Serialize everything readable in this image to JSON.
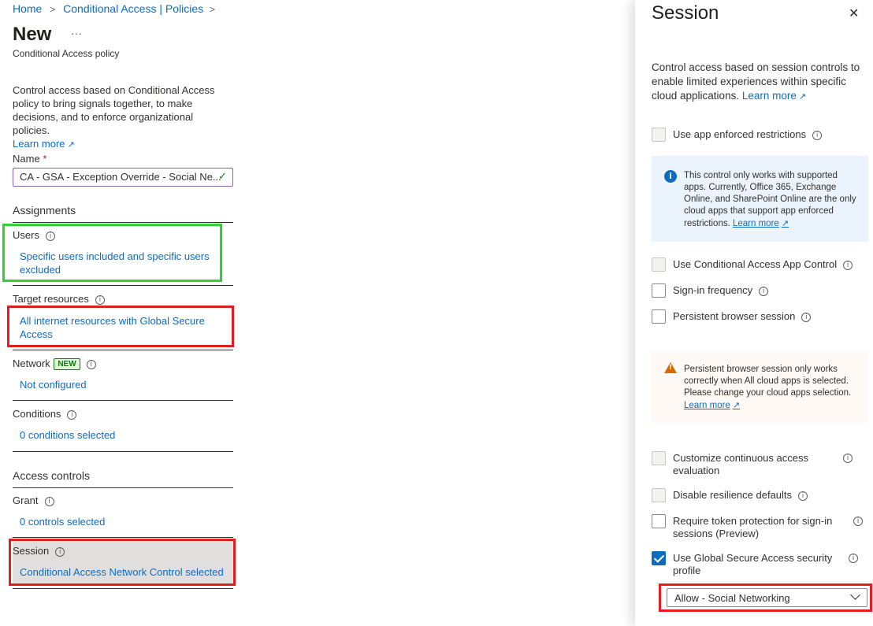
{
  "breadcrumb": {
    "home": "Home",
    "sep1": ">",
    "section": "Conditional Access | Policies",
    "sep2": ">"
  },
  "page": {
    "title": "New",
    "more": "···",
    "subtitle": "Conditional Access policy"
  },
  "intro": {
    "text": "Control access based on Conditional Access policy to bring signals together, to make decisions, and to enforce organizational policies.",
    "learn_more": "Learn more"
  },
  "name_field": {
    "label": "Name",
    "required": "*",
    "value": "CA - GSA - Exception Override - Social Ne...",
    "check": "✓"
  },
  "assignments": {
    "heading": "Assignments",
    "users": {
      "label": "Users",
      "value": "Specific users included and specific users excluded"
    },
    "target": {
      "label": "Target resources",
      "value": "All internet resources with Global Secure Access"
    },
    "network": {
      "label": "Network",
      "badge": "NEW",
      "value": "Not configured"
    },
    "conditions": {
      "label": "Conditions",
      "value": "0 conditions selected"
    }
  },
  "access_controls": {
    "heading": "Access controls",
    "grant": {
      "label": "Grant",
      "value": "0 controls selected"
    },
    "session": {
      "label": "Session",
      "value": "Conditional Access Network Control selected"
    }
  },
  "panel": {
    "title": "Session",
    "close": "✕",
    "description": "Control access based on session controls to enable limited experiences within specific cloud applications.",
    "learn_more": "Learn more",
    "app_enforced": "Use app enforced restrictions",
    "info_msg": "This control only works with supported apps. Currently, Office 365, Exchange Online, and SharePoint Online are the only cloud apps that support app enforced restrictions.",
    "info_learn_more": "Learn more",
    "ca_app_control": "Use Conditional Access App Control",
    "signin_freq": "Sign-in frequency",
    "persistent": "Persistent browser session",
    "warn_msg": "Persistent browser session only works correctly when All cloud apps is selected. Please change your cloud apps selection.",
    "warn_learn_more": "Learn more",
    "cae": "Customize continuous access evaluation",
    "resilience": "Disable resilience defaults",
    "token": "Require token protection for sign-in sessions (Preview)",
    "gsa_profile": "Use Global Secure Access security profile",
    "profile_select": "Allow - Social Networking"
  },
  "colors": {
    "link": "#0f6cbd",
    "highlight_red": "#e02020",
    "highlight_green": "#2fd22f",
    "info_blue": "#0f6cbd",
    "warn_orange": "#d66a00"
  }
}
